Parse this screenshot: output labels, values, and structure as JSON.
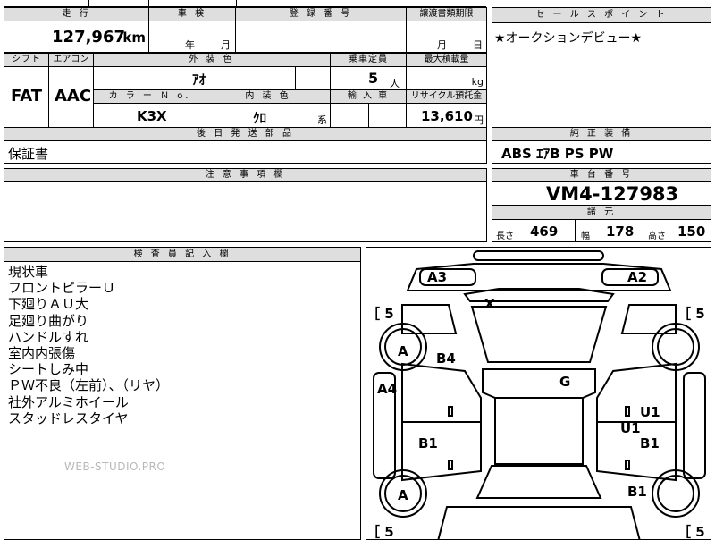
{
  "top": {
    "mileage_label": "走 行",
    "mileage_value": "127,967",
    "mileage_unit": "km",
    "inspection_label": "車 検",
    "inspection_year": "年",
    "inspection_month": "月",
    "registration_label": "登 録 番 号",
    "transfer_label": "譲渡書類期限",
    "transfer_month": "月",
    "transfer_day": "日"
  },
  "sales_point": {
    "label": "セ ー ル ス ポ イ ン ト",
    "text": "★オークションデビュー★"
  },
  "row2": {
    "shift_label": "シフト",
    "shift_value": "FAT",
    "ac_label": "エアコン",
    "ac_value": "AAC",
    "exterior_label": "外 装 色",
    "exterior_value": "ｱｵ",
    "capacity_label": "乗車定員",
    "capacity_value": "5",
    "capacity_unit": "人",
    "maxload_label": "最大積載量",
    "maxload_unit": "kg",
    "color_no_label": "カ ラ ー Ｎ o.",
    "color_no_value": "K3X",
    "interior_label": "内 装 色",
    "interior_value": "ｸﾛ",
    "interior_suffix": "系",
    "import_label": "輸 入 車",
    "recycle_label": "リサイクル預託金",
    "recycle_value": "13,610",
    "recycle_unit": "円"
  },
  "parts": {
    "label": "後 日 発 送 部 品",
    "value": "保証書"
  },
  "equipment": {
    "label": "純 正 装 備",
    "value": "ABS ｴｱB PS PW"
  },
  "notes": {
    "label": "注 意 事 項 欄"
  },
  "chassis": {
    "label": "車 台 番 号",
    "value": "VM4-127983",
    "spec_label": "諸 元",
    "length_label": "長さ",
    "length_value": "469",
    "width_label": "幅",
    "width_value": "178",
    "height_label": "高さ",
    "height_value": "150"
  },
  "inspector": {
    "label": "検 査 員 記 入 欄",
    "lines": [
      "現状車",
      "フロントピラーＵ",
      "下廻りＡＵ大",
      "足廻り曲がり",
      "ハンドルすれ",
      "室内内張傷",
      "シートしみ中",
      "ＰＷ不良（左前）、（リヤ）",
      "社外アルミホイール",
      "スタッドレスタイヤ"
    ],
    "watermark": "WEB-STUDIO.PRO"
  },
  "diagram": {
    "a3": "A3",
    "a2": "A2",
    "x": "X",
    "tire_fl": "［ 5",
    "tire_fr": "［ 5",
    "tire_rl": "［ 5",
    "tire_rr": "［ 5",
    "a_front_left": "A",
    "b4": "B4",
    "a4": "A4",
    "g": "G",
    "u1_right": "U1",
    "u1_center": "U1",
    "b1_left": "B1",
    "b1_right": "B1",
    "a_rear_left": "A",
    "b1_rear_right": "B1"
  }
}
